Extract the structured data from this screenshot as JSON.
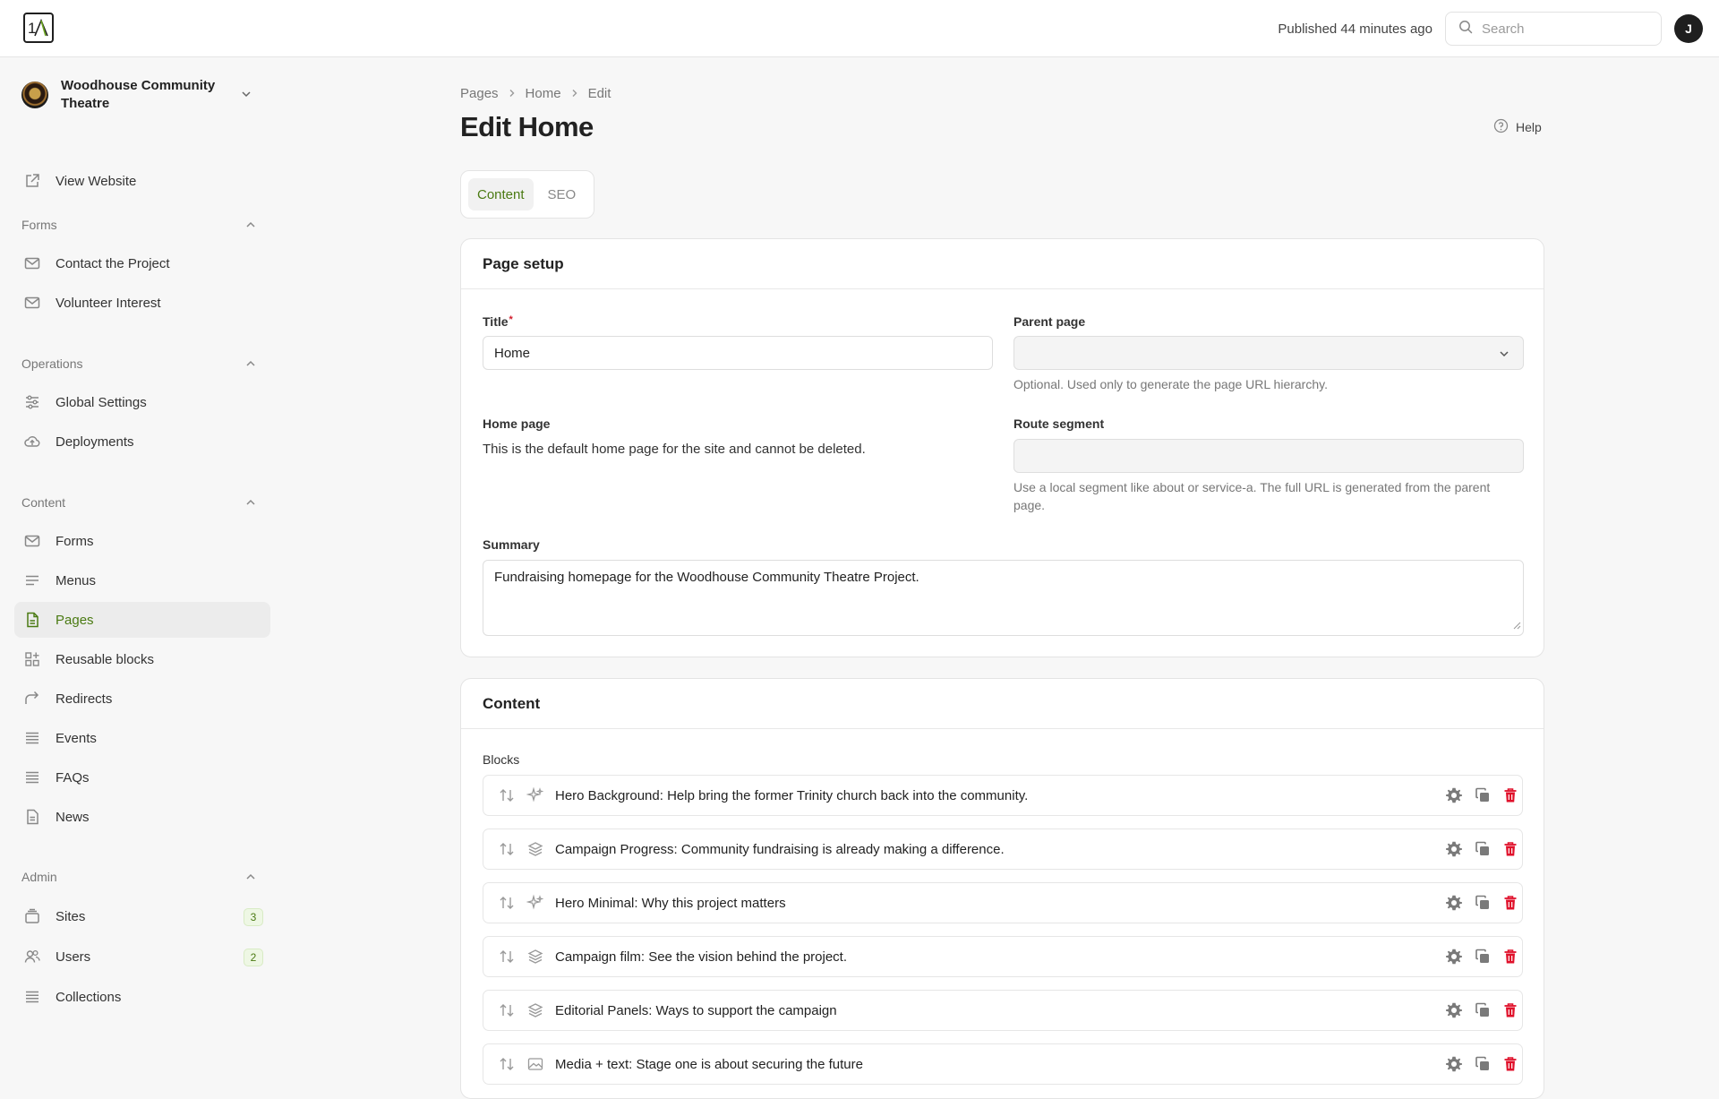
{
  "topbar": {
    "published": "Published 44 minutes ago",
    "search_placeholder": "Search",
    "avatar_initial": "J"
  },
  "sidebar": {
    "site_name": "Woodhouse Community Theatre",
    "view_website": "View Website",
    "sections": {
      "forms": "Forms",
      "operations": "Operations",
      "content": "Content",
      "admin": "Admin"
    },
    "forms_items": [
      {
        "label": "Contact the Project",
        "icon": "mail-icon"
      },
      {
        "label": "Volunteer Interest",
        "icon": "mail-icon"
      }
    ],
    "operations_items": [
      {
        "label": "Global Settings",
        "icon": "sliders-icon"
      },
      {
        "label": "Deployments",
        "icon": "cloud-upload-icon"
      }
    ],
    "content_items": [
      {
        "label": "Forms",
        "icon": "mail-icon"
      },
      {
        "label": "Menus",
        "icon": "menu-icon"
      },
      {
        "label": "Pages",
        "icon": "page-icon",
        "active": true
      },
      {
        "label": "Reusable blocks",
        "icon": "blocks-icon"
      },
      {
        "label": "Redirects",
        "icon": "redirect-icon"
      },
      {
        "label": "Events",
        "icon": "list-icon"
      },
      {
        "label": "FAQs",
        "icon": "list-icon"
      },
      {
        "label": "News",
        "icon": "document-icon"
      }
    ],
    "admin_items": [
      {
        "label": "Sites",
        "icon": "stack-icon",
        "badge": "3"
      },
      {
        "label": "Users",
        "icon": "users-icon",
        "badge": "2"
      },
      {
        "label": "Collections",
        "icon": "list-icon"
      }
    ]
  },
  "main": {
    "breadcrumb": [
      "Pages",
      "Home",
      "Edit"
    ],
    "title": "Edit Home",
    "help": "Help",
    "tabs": [
      {
        "label": "Content",
        "active": true
      },
      {
        "label": "SEO",
        "active": false
      }
    ],
    "page_setup": {
      "heading": "Page setup",
      "title_label": "Title",
      "title_required": "*",
      "title_value": "Home",
      "parent_label": "Parent page",
      "parent_value": "",
      "parent_help": "Optional. Used only to generate the page URL hierarchy.",
      "home_label": "Home page",
      "home_text": "This is the default home page for the site and cannot be deleted.",
      "route_label": "Route segment",
      "route_value": "",
      "route_help": "Use a local segment like about or service-a. The full URL is generated from the parent page.",
      "summary_label": "Summary",
      "summary_value": "Fundraising homepage for the Woodhouse Community Theatre Project."
    },
    "content": {
      "heading": "Content",
      "blocks_label": "Blocks",
      "blocks": [
        {
          "title": "Hero Background: Help bring the former Trinity church back into the community.",
          "icon": "sparkle-icon"
        },
        {
          "title": "Campaign Progress: Community fundraising is already making a difference.",
          "icon": "layers-icon"
        },
        {
          "title": "Hero Minimal: Why this project matters",
          "icon": "sparkle-icon"
        },
        {
          "title": "Campaign film: See the vision behind the project.",
          "icon": "layers-icon"
        },
        {
          "title": "Editorial Panels: Ways to support the campaign",
          "icon": "layers-icon"
        },
        {
          "title": "Media + text: Stage one is about securing the future",
          "icon": "image-icon"
        }
      ]
    }
  },
  "colors": {
    "accent_green": "#4a7a12",
    "delete_red": "#e0112b",
    "required_red": "#d11a2a"
  }
}
